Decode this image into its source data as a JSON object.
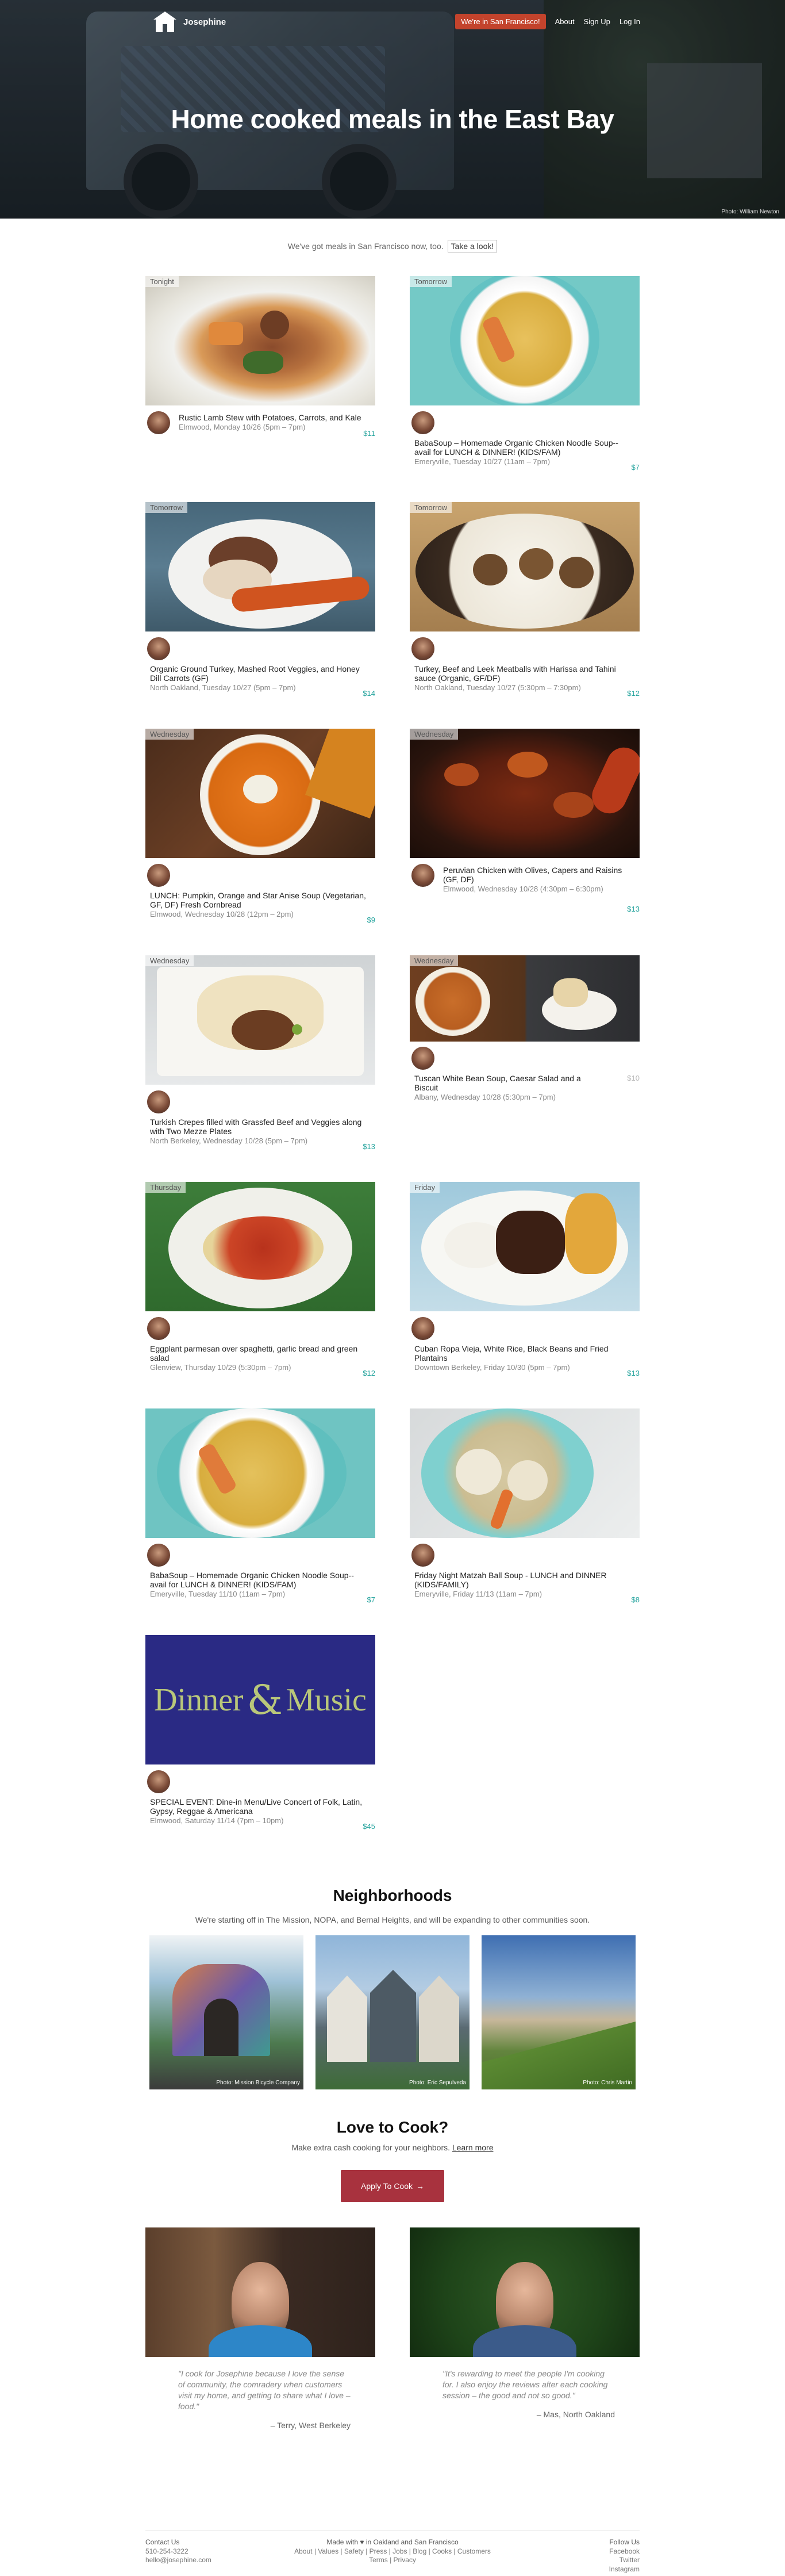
{
  "nav": {
    "brand": "Josephine",
    "sf_pill": "We're in San Francisco!",
    "about": "About",
    "signup": "Sign Up",
    "login": "Log In"
  },
  "hero": {
    "title": "Home cooked meals in the East Bay",
    "photo_credit": "Photo: William Newton"
  },
  "sf_banner": {
    "text": "We've got meals in San Francisco now, too.",
    "link": "Take a look!"
  },
  "meals": [
    {
      "day": "Tonight",
      "title": "Rustic Lamb Stew with Potatoes, Carrots, and Kale",
      "meta": "Elmwood, Monday 10/26 (5pm – 7pm)",
      "price": "$11"
    },
    {
      "day": "Tomorrow",
      "title": "BabaSoup – Homemade Organic Chicken Noodle Soup--avail for LUNCH & DINNER! (KIDS/FAM)",
      "meta": "Emeryville, Tuesday 10/27 (11am – 7pm)",
      "price": "$7"
    },
    {
      "day": "Tomorrow",
      "title": "Organic Ground Turkey, Mashed Root Veggies, and Honey Dill Carrots (GF)",
      "meta": "North Oakland, Tuesday 10/27 (5pm – 7pm)",
      "price": "$14"
    },
    {
      "day": "Tomorrow",
      "title": "Turkey, Beef and Leek Meatballs with Harissa and Tahini sauce (Organic, GF/DF)",
      "meta": "North Oakland, Tuesday 10/27 (5:30pm – 7:30pm)",
      "price": "$12"
    },
    {
      "day": "Wednesday",
      "title": "LUNCH: Pumpkin, Orange and Star Anise Soup (Vegetarian, GF, DF) Fresh Cornbread",
      "meta": "Elmwood, Wednesday 10/28 (12pm – 2pm)",
      "price": "$9"
    },
    {
      "day": "Wednesday",
      "title": "Peruvian Chicken with Olives, Capers and Raisins (GF, DF)",
      "meta": "Elmwood, Wednesday 10/28 (4:30pm – 6:30pm)",
      "price": "$13"
    },
    {
      "day": "Wednesday",
      "title": "Turkish Crepes filled with Grassfed Beef and Veggies along with Two Mezze Plates",
      "meta": "North Berkeley, Wednesday 10/28 (5pm – 7pm)",
      "price": "$13"
    },
    {
      "day": "Wednesday",
      "title": "Tuscan White Bean Soup, Caesar Salad and a Biscuit",
      "meta": "Albany, Wednesday 10/28 (5:30pm – 7pm)",
      "price": "$10"
    },
    {
      "day": "Thursday",
      "title": "Eggplant parmesan over spaghetti, garlic bread and green salad",
      "meta": "Glenview, Thursday 10/29 (5:30pm – 7pm)",
      "price": "$12"
    },
    {
      "day": "Friday",
      "title": "Cuban Ropa Vieja, White Rice, Black Beans and Fried Plantains",
      "meta": "Downtown Berkeley, Friday 10/30 (5pm – 7pm)",
      "price": "$13"
    },
    {
      "day": "",
      "title": "BabaSoup – Homemade Organic Chicken Noodle Soup--avail for LUNCH & DINNER! (KIDS/FAM)",
      "meta": "Emeryville, Tuesday 11/10 (11am – 7pm)",
      "price": "$7"
    },
    {
      "day": "",
      "title": "Friday Night Matzah Ball Soup - LUNCH and DINNER (KIDS/FAMILY)",
      "meta": "Emeryville, Friday 11/13 (11am – 7pm)",
      "price": "$8"
    },
    {
      "day": "",
      "title": "SPECIAL EVENT: Dine-in Menu/Live Concert of Folk, Latin, Gypsy, Reggae & Americana",
      "meta": "Elmwood, Saturday 11/14 (7pm – 10pm)",
      "price": "$45"
    }
  ],
  "event_image": {
    "word1": "Dinner",
    "word2": "Music"
  },
  "neighborhoods": {
    "title": "Neighborhoods",
    "subtitle": "We're starting off in The Mission, NOPA, and Bernal Heights, and will be expanding to other communities soon.",
    "credits": [
      "Photo: Mission Bicycle Company",
      "Photo: Eric Sepulveda",
      "Photo: Chris Martin"
    ]
  },
  "cook": {
    "title": "Love to Cook?",
    "subtitle": "Make extra cash cooking for your neighbors.",
    "learn_more": "Learn more",
    "apply": "Apply To Cook",
    "quotes": [
      {
        "text": "\"I cook for Josephine because I love the sense of community, the comradery when customers visit my home, and getting to share what I love – food.\"",
        "by": "– Terry, West Berkeley"
      },
      {
        "text": "\"It's rewarding to meet the people I'm cooking for. I also enjoy the reviews after each cooking session – the good and not so good.\"",
        "by": "– Mas, North Oakland"
      }
    ]
  },
  "footer": {
    "contact_title": "Contact Us",
    "phone": "510-254-3222",
    "email": "hello@josephine.com",
    "made_with": "Made with ♥ in Oakland and San Francisco",
    "links_row1": "About | Values | Safety | Press | Jobs | Blog | Cooks | Customers",
    "links_row2": "Terms | Privacy",
    "follow_title": "Follow Us",
    "facebook": "Facebook",
    "twitter": "Twitter",
    "instagram": "Instagram"
  },
  "colors": {
    "accent": "#c3432c",
    "price": "#2aa6a0",
    "apply": "#a8323e"
  }
}
